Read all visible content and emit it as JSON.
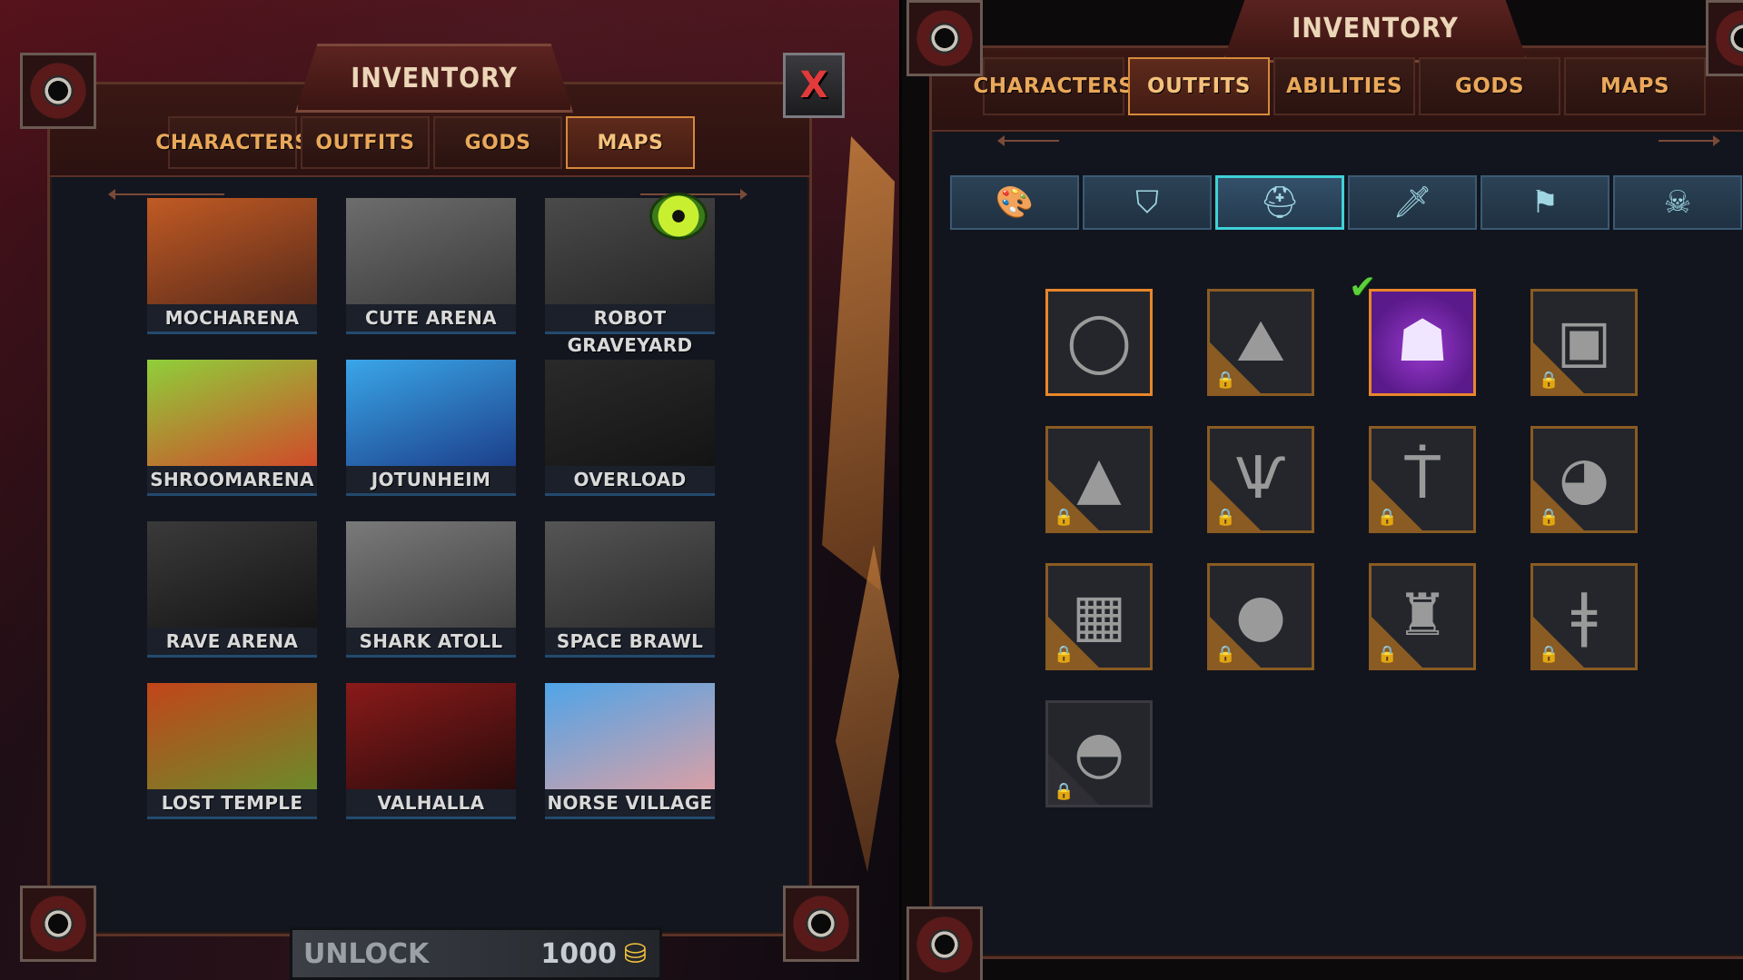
{
  "left": {
    "title": "INVENTORY",
    "tabs": [
      {
        "label": "CHARACTERS",
        "active": false
      },
      {
        "label": "OUTFITS",
        "active": false
      },
      {
        "label": "GODS",
        "active": false
      },
      {
        "label": "MAPS",
        "active": true
      }
    ],
    "close_label": "X",
    "maps": [
      {
        "name": "MOCHARENA",
        "colors": [
          "#c15a24",
          "#5a2b1a"
        ],
        "state": "color"
      },
      {
        "name": "CUTE ARENA",
        "colors": [
          "#6d6d6d",
          "#3a3a3a"
        ],
        "state": "grayscale"
      },
      {
        "name": "ROBOT GRAVEYARD",
        "colors": [
          "#4a4a4a",
          "#262626"
        ],
        "state": "grayscale",
        "badge": "green-eye-icon"
      },
      {
        "name": "SHROOMARENA",
        "colors": [
          "#8fcf3a",
          "#d04a2a"
        ],
        "state": "color"
      },
      {
        "name": "JOTUNHEIM",
        "colors": [
          "#3aa6e8",
          "#1c3f8a"
        ],
        "state": "color"
      },
      {
        "name": "OVERLOAD",
        "colors": [
          "#2a2a2a",
          "#141414"
        ],
        "state": "grayscale"
      },
      {
        "name": "RAVE ARENA",
        "colors": [
          "#3a3a3a",
          "#151515"
        ],
        "state": "grayscale"
      },
      {
        "name": "SHARK ATOLL",
        "colors": [
          "#7a7a7a",
          "#3f3f3f"
        ],
        "state": "grayscale"
      },
      {
        "name": "SPACE BRAWL",
        "colors": [
          "#555555",
          "#2a2a2a"
        ],
        "state": "grayscale"
      },
      {
        "name": "LOST TEMPLE",
        "colors": [
          "#c2451a",
          "#6c8a2a"
        ],
        "state": "color"
      },
      {
        "name": "VALHALLA",
        "colors": [
          "#8a1a1a",
          "#2a0b0b"
        ],
        "state": "color"
      },
      {
        "name": "NORSE VILLAGE",
        "colors": [
          "#4fa4e8",
          "#d9a0a6"
        ],
        "state": "color"
      }
    ],
    "unlock": {
      "label": "UNLOCK",
      "cost": "1000",
      "currency_icon": "gold-pile-icon"
    }
  },
  "right": {
    "title": "INVENTORY",
    "tabs": [
      {
        "label": "CHARACTERS",
        "active": false
      },
      {
        "label": "OUTFITS",
        "active": true
      },
      {
        "label": "ABILITIES",
        "active": false
      },
      {
        "label": "GODS",
        "active": false
      },
      {
        "label": "MAPS",
        "active": false
      }
    ],
    "categories": [
      {
        "icon": "palette-icon",
        "glyph": "🎨",
        "active": false
      },
      {
        "icon": "shield-icon",
        "glyph": "⛉",
        "active": false
      },
      {
        "icon": "helmet-icon",
        "glyph": "⛑",
        "active": true
      },
      {
        "icon": "sword-icon",
        "glyph": "🗡",
        "active": false
      },
      {
        "icon": "flag-icon",
        "glyph": "⚑",
        "active": false
      },
      {
        "icon": "skull-icon",
        "glyph": "☠",
        "active": false
      }
    ],
    "outfits": [
      {
        "icon": "ring-icon",
        "glyph": "◯",
        "locked": false,
        "equipped": false,
        "selected": true
      },
      {
        "icon": "stone-helmet-icon",
        "glyph": "⛰",
        "locked": true,
        "equipped": false
      },
      {
        "icon": "tribal-mask-icon",
        "glyph": "☗",
        "locked": false,
        "equipped": true
      },
      {
        "icon": "knight-visor-icon",
        "glyph": "▣",
        "locked": true,
        "equipped": false
      },
      {
        "icon": "witch-hat-icon",
        "glyph": "▲",
        "locked": true,
        "equipped": false
      },
      {
        "icon": "winged-helmet-icon",
        "glyph": "Ѱ",
        "locked": true,
        "equipped": false
      },
      {
        "icon": "hammer-helmet-icon",
        "glyph": "Ṫ",
        "locked": true,
        "equipped": false
      },
      {
        "icon": "diving-helmet-icon",
        "glyph": "◕",
        "locked": true,
        "equipped": false
      },
      {
        "icon": "box-head-icon",
        "glyph": "▦",
        "locked": true,
        "equipped": false
      },
      {
        "icon": "panda-hood-icon",
        "glyph": "●",
        "locked": true,
        "equipped": false
      },
      {
        "icon": "bunny-ear-helmet-icon",
        "glyph": "♜",
        "locked": true,
        "equipped": false
      },
      {
        "icon": "antenna-helmet-icon",
        "glyph": "ǂ",
        "locked": true,
        "equipped": false
      },
      {
        "icon": "bat-mask-icon",
        "glyph": "◓",
        "locked": true,
        "equipped": false,
        "dim": true
      }
    ]
  }
}
